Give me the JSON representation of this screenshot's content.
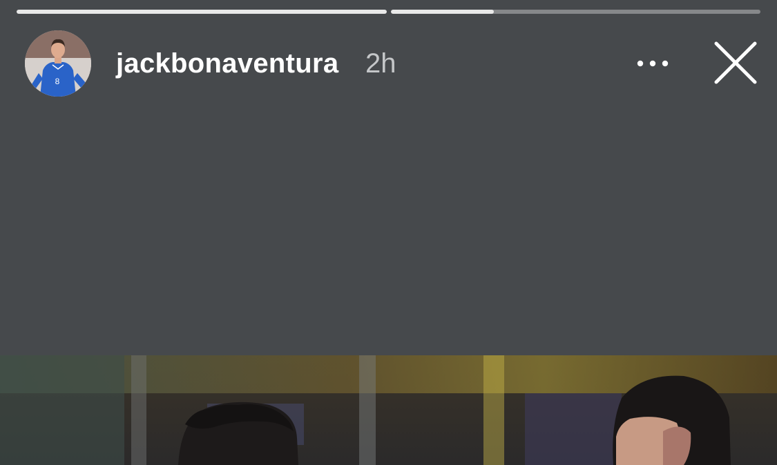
{
  "story": {
    "username": "jackbonaventura",
    "timestamp": "2h",
    "progress": [
      1.0,
      0.28
    ]
  },
  "icons": {
    "more": "more-horizontal-icon",
    "close": "close-icon"
  },
  "colors": {
    "background": "#46494c",
    "progress_active": "#e9e9e9",
    "username": "#ffffff",
    "timestamp": "#c4c6c8"
  }
}
